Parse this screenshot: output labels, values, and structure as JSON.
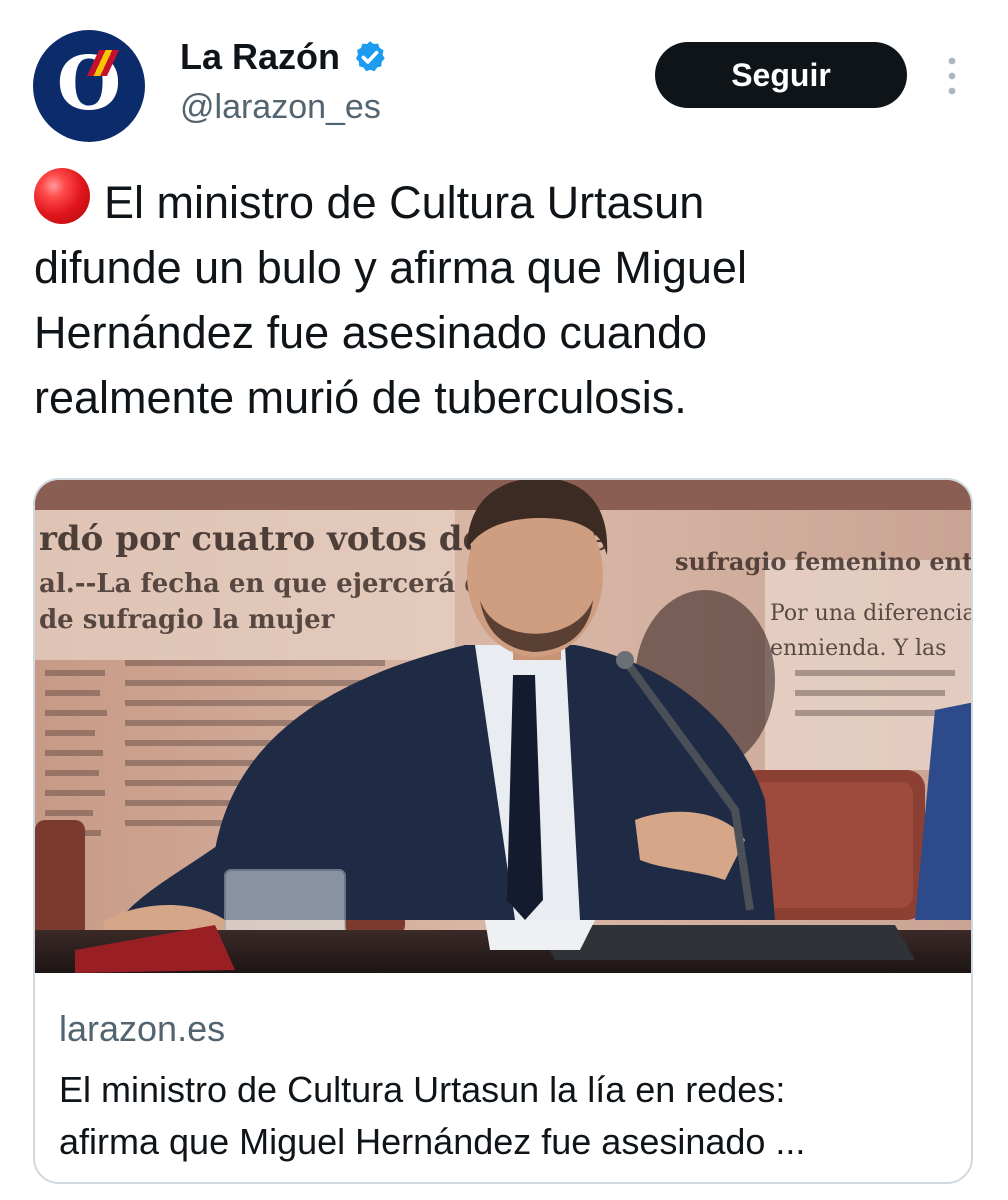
{
  "author": {
    "display_name": "La Razón",
    "handle": "@larazon_es",
    "avatar_letter": "O",
    "verified": true
  },
  "actions": {
    "follow_label": "Seguir"
  },
  "tweet": {
    "emoji": "red-circle",
    "lines": [
      "El ministro de Cultura Urtasun",
      "difunde un bulo y afirma que Miguel",
      "Hernández fue asesinado cuando",
      "realmente murió de tuberculosis."
    ]
  },
  "link_card": {
    "domain": "larazon.es",
    "title_lines": [
      "El ministro de Cultura Urtasun la lía en redes:",
      "afirma que Miguel Hernández fue asesinado ..."
    ],
    "image": {
      "newspaper_lines": [
        "rdó por cuatro votos de difere",
        "al.--La fecha en que ejercerá el",
        "de sufragio la mujer"
      ],
      "newspaper_right_lines": [
        "sufragio femenino entre",
        "Por una diferencia",
        "enmienda. Y las"
      ]
    }
  },
  "colors": {
    "text_primary": "#0f1419",
    "text_secondary": "#536471",
    "verified_blue": "#1d9bf0",
    "avatar_bg": "#0b2b6b",
    "border": "#cfd9de"
  }
}
